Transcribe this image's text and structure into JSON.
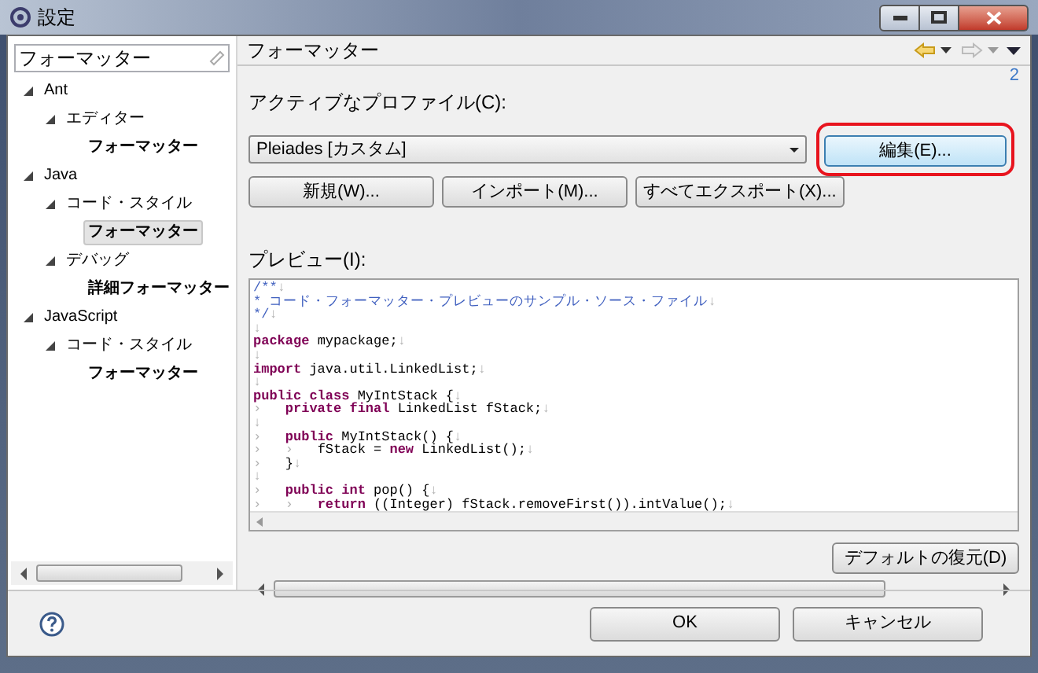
{
  "window": {
    "title": "設定"
  },
  "filter": {
    "value": "フォーマッター"
  },
  "tree": [
    {
      "label": "Ant",
      "expanded": true,
      "selected": false,
      "children": [
        {
          "label": "エディター",
          "expanded": true,
          "selected": false,
          "children": [
            {
              "label": "フォーマッター",
              "selected": false
            }
          ]
        }
      ]
    },
    {
      "label": "Java",
      "expanded": true,
      "selected": false,
      "children": [
        {
          "label": "コード・スタイル",
          "expanded": true,
          "selected": false,
          "children": [
            {
              "label": "フォーマッター",
              "selected": true
            }
          ]
        },
        {
          "label": "デバッグ",
          "expanded": true,
          "selected": false,
          "children": [
            {
              "label": "詳細フォーマッター",
              "selected": false
            }
          ]
        }
      ]
    },
    {
      "label": "JavaScript",
      "expanded": true,
      "selected": false,
      "children": [
        {
          "label": "コード・スタイル",
          "expanded": true,
          "selected": false,
          "children": [
            {
              "label": "フォーマッター",
              "selected": false
            }
          ]
        }
      ]
    }
  ],
  "page": {
    "title": "フォーマッター",
    "link": "2",
    "profile_label": "アクティブなプロファイル(C):",
    "profile_value": "Pleiades [カスタム]",
    "edit_button": {
      "label": "編集(E)...",
      "highlighted": true
    },
    "buttons": [
      "新規(W)...",
      "インポート(M)...",
      "すべてエクスポート(X)..."
    ],
    "preview_label": "プレビュー(I):",
    "preview_lines": [
      [
        {
          "kind": "comment",
          "text": "/**"
        },
        {
          "kind": "ws",
          "text": "↓"
        }
      ],
      [
        {
          "kind": "comment",
          "text": "* コード・フォーマッター・プレビューのサンプル・ソース・ファイル"
        },
        {
          "kind": "ws",
          "text": "↓"
        }
      ],
      [
        {
          "kind": "comment",
          "text": "*/"
        },
        {
          "kind": "ws",
          "text": "↓"
        }
      ],
      [
        {
          "kind": "ws",
          "text": "↓"
        }
      ],
      [
        {
          "kind": "keyword",
          "text": "package"
        },
        {
          "kind": "plain",
          "text": " mypackage;"
        },
        {
          "kind": "ws",
          "text": "↓"
        }
      ],
      [
        {
          "kind": "ws",
          "text": "↓"
        }
      ],
      [
        {
          "kind": "keyword",
          "text": "import"
        },
        {
          "kind": "plain",
          "text": " java.util.LinkedList;"
        },
        {
          "kind": "ws",
          "text": "↓"
        }
      ],
      [
        {
          "kind": "ws",
          "text": "↓"
        }
      ],
      [
        {
          "kind": "keyword",
          "text": "public class"
        },
        {
          "kind": "plain",
          "text": " MyIntStack {"
        },
        {
          "kind": "ws",
          "text": "↓"
        }
      ],
      [
        {
          "kind": "ws",
          "text": "›   "
        },
        {
          "kind": "keyword",
          "text": "private final"
        },
        {
          "kind": "plain",
          "text": " LinkedList fStack;"
        },
        {
          "kind": "ws",
          "text": "↓"
        }
      ],
      [
        {
          "kind": "ws",
          "text": "↓"
        }
      ],
      [
        {
          "kind": "ws",
          "text": "›   "
        },
        {
          "kind": "keyword",
          "text": "public"
        },
        {
          "kind": "plain",
          "text": " MyIntStack() {"
        },
        {
          "kind": "ws",
          "text": "↓"
        }
      ],
      [
        {
          "kind": "ws",
          "text": "›   ›   "
        },
        {
          "kind": "plain",
          "text": "fStack = "
        },
        {
          "kind": "keyword",
          "text": "new"
        },
        {
          "kind": "plain",
          "text": " LinkedList();"
        },
        {
          "kind": "ws",
          "text": "↓"
        }
      ],
      [
        {
          "kind": "ws",
          "text": "›   "
        },
        {
          "kind": "plain",
          "text": "}"
        },
        {
          "kind": "ws",
          "text": "↓"
        }
      ],
      [
        {
          "kind": "ws",
          "text": "↓"
        }
      ],
      [
        {
          "kind": "ws",
          "text": "›   "
        },
        {
          "kind": "keyword",
          "text": "public int"
        },
        {
          "kind": "plain",
          "text": " pop() {"
        },
        {
          "kind": "ws",
          "text": "↓"
        }
      ],
      [
        {
          "kind": "ws",
          "text": "›   ›   "
        },
        {
          "kind": "keyword",
          "text": "return"
        },
        {
          "kind": "plain",
          "text": " ((Integer) fStack.removeFirst()).intValue();"
        },
        {
          "kind": "ws",
          "text": "↓"
        }
      ]
    ],
    "restore_button": "デフォルトの復元(D)"
  },
  "footer": {
    "buttons": [
      "OK",
      "キャンセル"
    ]
  }
}
